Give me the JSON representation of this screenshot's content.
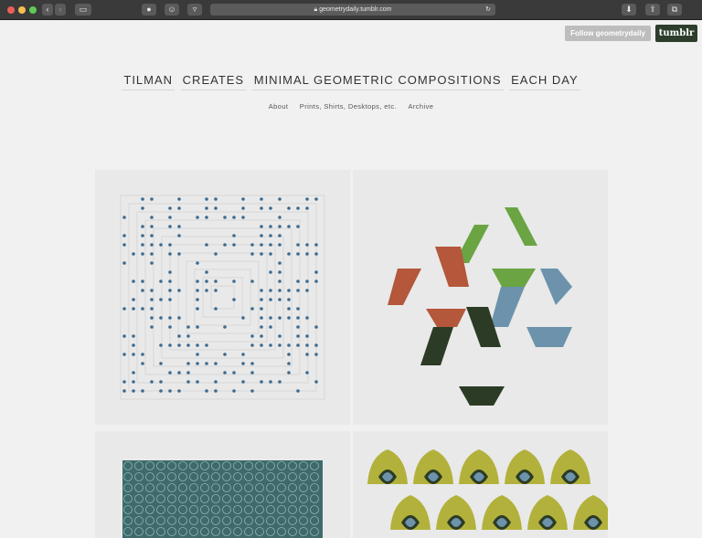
{
  "browser": {
    "url": "geometrydaily.tumblr.com",
    "traffic_lights": [
      "#ee5f57",
      "#f6be4f",
      "#5fcb56"
    ]
  },
  "header": {
    "follow_label": "Follow geometrydaily",
    "tumblr_label": "tumblr",
    "title_words": [
      "TILMAN",
      "CREATES",
      "MINIMAL GEOMETRIC COMPOSITIONS",
      "EACH DAY"
    ],
    "nav": [
      "About",
      "Prints, Shirts, Desktops, etc.",
      "Archive"
    ]
  },
  "colors": {
    "dot_blue": "#3e6b8f",
    "green": "#6aa443",
    "rust": "#b4573a",
    "steel": "#6c93ab",
    "dark": "#2c3b25",
    "teal": "#3e6a6c",
    "olive": "#b2b13b"
  }
}
